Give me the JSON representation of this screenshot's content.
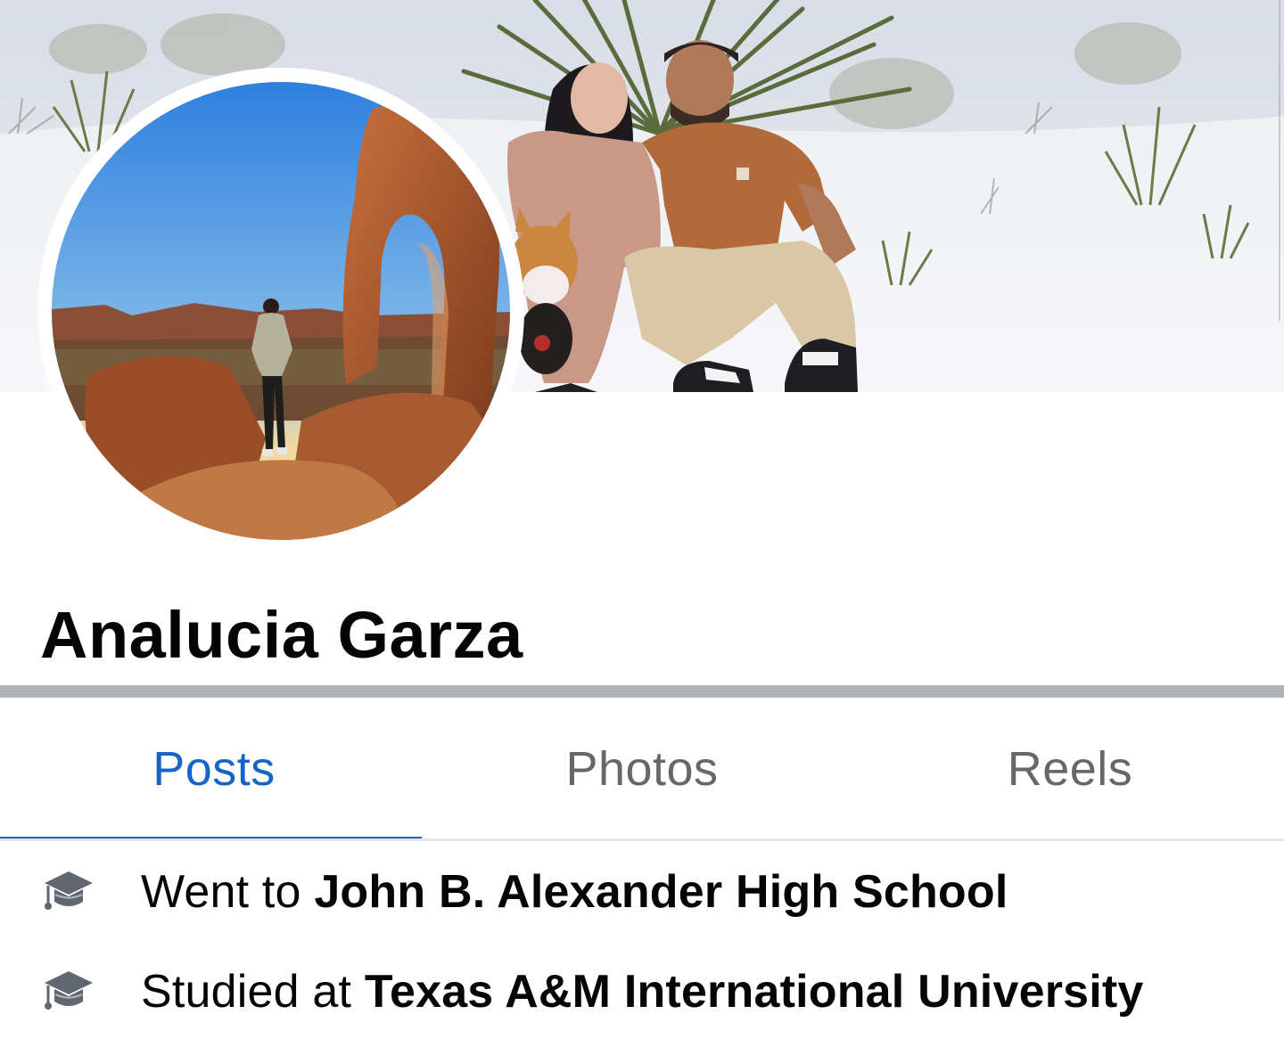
{
  "profile": {
    "name": "Analucia Garza"
  },
  "tabs": [
    {
      "label": "Posts",
      "active": true
    },
    {
      "label": "Photos",
      "active": false
    },
    {
      "label": "Reels",
      "active": false
    }
  ],
  "intro": [
    {
      "icon": "graduation-cap-icon",
      "prefix": "Went to",
      "place": "John B. Alexander High School"
    },
    {
      "icon": "graduation-cap-icon",
      "prefix": "Studied at",
      "place": "Texas A&M International University"
    }
  ],
  "colors": {
    "active_tab": "#1565c8",
    "inactive_tab": "#65676b",
    "text": "#050505",
    "divider": "#b0b3b8"
  }
}
